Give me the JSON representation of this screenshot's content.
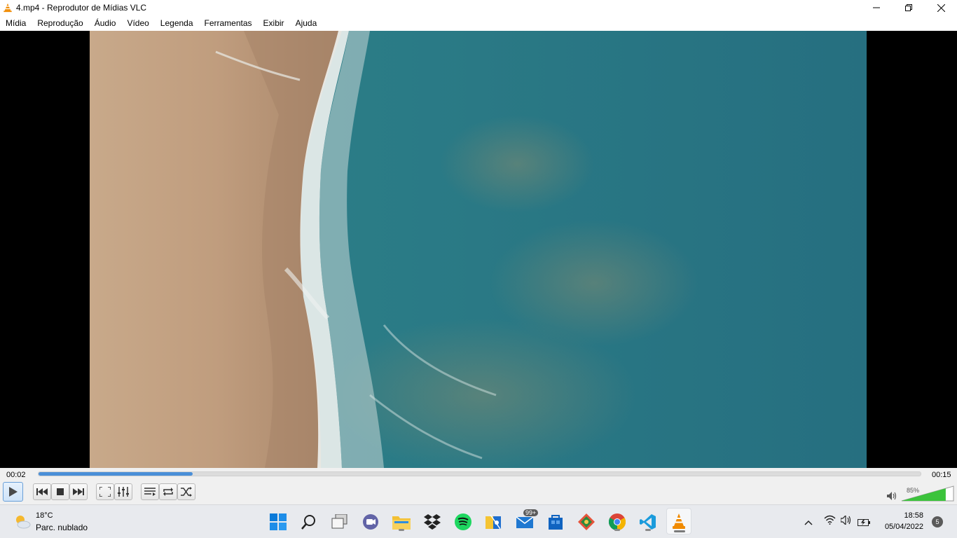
{
  "window": {
    "title": "4.mp4 - Reprodutor de Mídias VLC"
  },
  "menu": [
    "Mídia",
    "Reprodução",
    "Áudio",
    "Vídeo",
    "Legenda",
    "Ferramentas",
    "Exibir",
    "Ajuda"
  ],
  "playback": {
    "elapsed": "00:02",
    "total": "00:15",
    "progress_fraction": 0.175,
    "volume_label": "85%",
    "volume_fraction": 0.85
  },
  "colors": {
    "seek_fill": "#4a8fd8",
    "volume_fill": "#3cc33c",
    "vlc_orange": "#f08a00"
  },
  "taskbar": {
    "weather_temp": "18°C",
    "weather_desc": "Parc. nublado",
    "mail_badge": "99+",
    "time": "18:58",
    "date": "05/04/2022",
    "notification_count": "5",
    "apps": [
      "start-icon",
      "search-icon",
      "task-view-icon",
      "teams-chat-icon",
      "file-explorer-icon",
      "dropbox-icon",
      "spotify-icon",
      "snip-sketch-icon",
      "mail-icon",
      "store-icon",
      "git-icon",
      "chrome-icon",
      "vscode-icon",
      "vlc-icon"
    ]
  }
}
